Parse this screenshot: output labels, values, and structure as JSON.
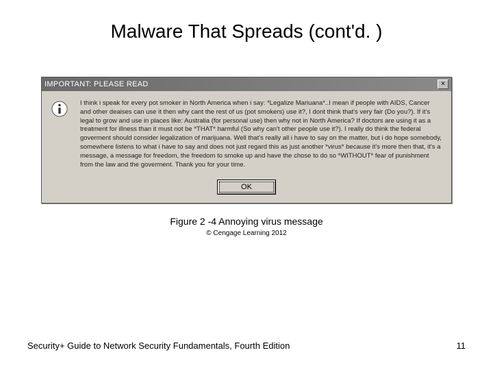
{
  "slide": {
    "title": "Malware That Spreads (cont'd. )"
  },
  "dialog": {
    "titlebar": "IMPORTANT: PLEASE READ",
    "close_label": "×",
    "message": "I think i speak for every pot smoker in North America when i say: *Legalize Mariuana*..I mean if people with AIDS, Cancer and other deaises can use it then why cant the rest of us (pot smokers) use it?, I dont think that's very fair (Do you?). If it's legal to grow and use in places like: Australia (for personal use) then why not in North America? If doctors are using it as a treatment for illness than it must not be *THAT* harmful (So why can't other people use it?). I really do think the federal goverment should consider legalization of marijuana. Well that's really all i have to say on the matter, but i do hope somebody, somewhere listens to what i have to say and does not just regard this as just another *virus* because it's more then that, it's a message, a message for freedom, the freedom to smoke up and have the chose to do so *WITHOUT* fear of punishment from the law and the goverment. Thank you for your time.",
    "ok_label": "OK"
  },
  "caption": {
    "figure": "Figure 2 -4 Annoying virus message",
    "copyright": "© Cengage Learning 2012"
  },
  "footer": {
    "text": "Security+ Guide to Network Security Fundamentals, Fourth Edition",
    "page": "11"
  }
}
